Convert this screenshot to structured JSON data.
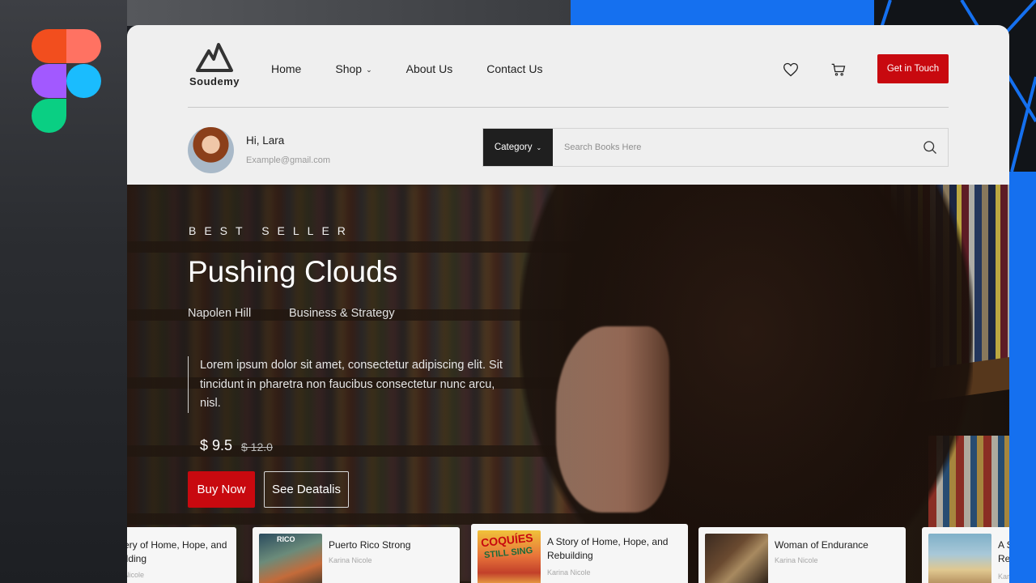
{
  "brand": {
    "name": "Soudemy"
  },
  "nav": {
    "links": [
      {
        "label": "Home"
      },
      {
        "label": "Shop",
        "has_dropdown": true
      },
      {
        "label": "About Us"
      },
      {
        "label": "Contact Us"
      }
    ],
    "cta_label": "Get in Touch"
  },
  "user": {
    "greeting": "Hi, Lara",
    "email": "Example@gmail.com"
  },
  "search": {
    "category_label": "Category",
    "placeholder": "Search Books Here"
  },
  "hero": {
    "eyebrow": "BEST SELLER",
    "title": "Pushing Clouds",
    "author": "Napolen Hill",
    "category": "Business & Strategy",
    "description": "Lorem ipsum dolor sit amet, consectetur adipiscing elit. Sit tincidunt in pharetra non faucibus consectetur nunc arcu, nisl.",
    "price": "$ 9.5",
    "old_price": "$ 12.0",
    "buy_label": "Buy Now",
    "details_label": "See Deatalis"
  },
  "books": [
    {
      "title": "ery of Home, Hope, and ilding",
      "author": "Nicole"
    },
    {
      "title": "Puerto Rico Strong",
      "author": "Karina Nicole"
    },
    {
      "title": "A Story of Home, Hope, and Rebuilding",
      "author": "Karina Nicole"
    },
    {
      "title": "Woman of Endurance",
      "author": "Karina Nicole"
    },
    {
      "title": "A S Re",
      "author": "Kar"
    }
  ],
  "colors": {
    "accent": "#c8090f",
    "dark": "#1f1f1f",
    "window_bg": "#efefef",
    "desktop_blue": "#1570ef"
  },
  "icons": {
    "wishlist": "heart-icon",
    "cart": "cart-icon",
    "search": "search-icon",
    "logo": "mountain-logo-icon"
  }
}
